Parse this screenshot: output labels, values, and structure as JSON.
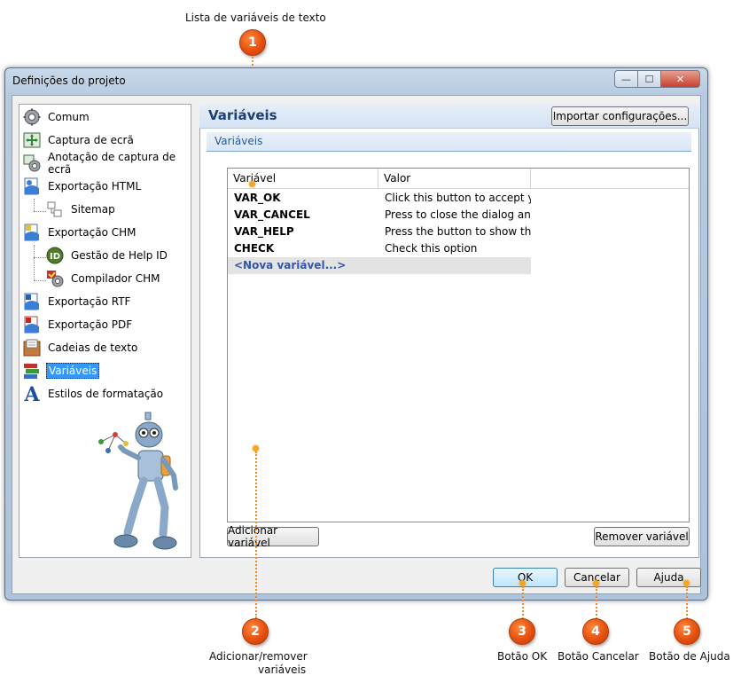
{
  "callouts": {
    "c1": {
      "number": "1",
      "label": "Lista de variáveis de texto"
    },
    "c2": {
      "number": "2",
      "label_line1": "Adicionar/remover",
      "label_line2": "variáveis"
    },
    "c3": {
      "number": "3",
      "label": "Botão OK"
    },
    "c4": {
      "number": "4",
      "label": "Botão Cancelar"
    },
    "c5": {
      "number": "5",
      "label": "Botão de Ajuda"
    },
    "color": "#e5500f"
  },
  "window": {
    "title": "Definições do projeto",
    "controls": {
      "minimize": "—",
      "maximize": "☐",
      "close": "✕"
    }
  },
  "sidebar": {
    "items": [
      {
        "label": "Comum",
        "icon": "gear-icon"
      },
      {
        "label": "Captura de ecrã",
        "icon": "screen-capture-icon"
      },
      {
        "label": "Anotação de captura de ecrã",
        "icon": "annotation-gear-icon"
      },
      {
        "label": "Exportação HTML",
        "icon": "html-export-icon"
      },
      {
        "label": "Sitemap",
        "icon": "sitemap-icon"
      },
      {
        "label": "Exportação CHM",
        "icon": "chm-export-icon"
      },
      {
        "label": "Gestão de Help ID",
        "icon": "help-id-icon"
      },
      {
        "label": "Compilador CHM",
        "icon": "chm-compiler-icon"
      },
      {
        "label": "Exportação RTF",
        "icon": "rtf-export-icon"
      },
      {
        "label": "Exportação PDF",
        "icon": "pdf-export-icon"
      },
      {
        "label": "Cadeias de texto",
        "icon": "text-strings-icon"
      },
      {
        "label": "Variáveis",
        "icon": "variables-icon",
        "selected": true
      },
      {
        "label": "Estilos de formatação",
        "icon": "format-styles-icon"
      }
    ]
  },
  "main": {
    "header_title": "Variáveis",
    "import_button": "Importar configurações...",
    "section_title": "Variáveis",
    "grid": {
      "columns": [
        "Variável",
        "Valor"
      ],
      "rows": [
        {
          "name": "VAR_OK",
          "value": "Click this button to accept yo..."
        },
        {
          "name": "VAR_CANCEL",
          "value": "Press to close the dialog an..."
        },
        {
          "name": "VAR_HELP",
          "value": "Press the button to show th..."
        },
        {
          "name": "CHECK",
          "value": "Check this option"
        }
      ],
      "new_row": "<Nova variável...>"
    },
    "add_button": "Adicionar variável",
    "remove_button": "Remover variável"
  },
  "footer": {
    "ok": "OK",
    "cancel": "Cancelar",
    "help": "Ajuda"
  }
}
